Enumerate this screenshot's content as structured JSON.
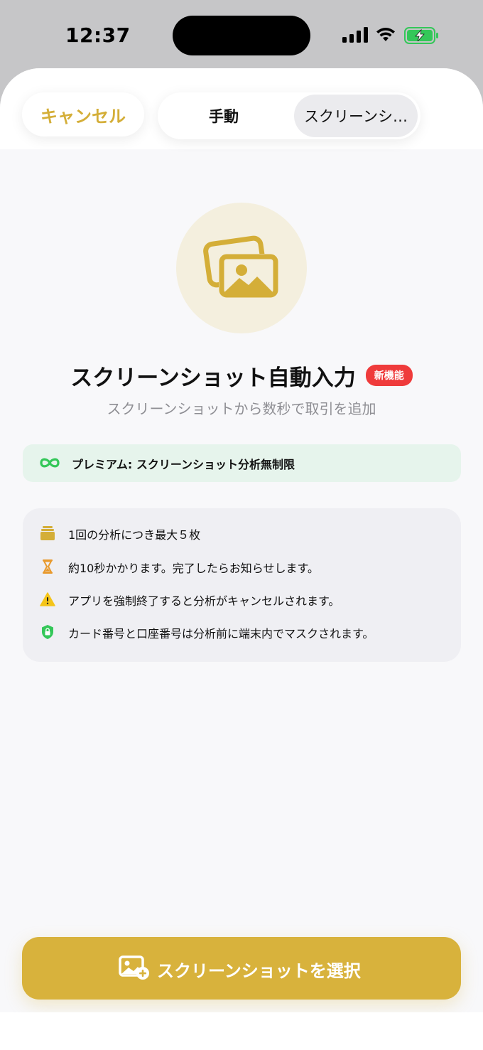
{
  "status_bar": {
    "time": "12:37"
  },
  "header": {
    "cancel_label": "キャンセル",
    "segments": [
      {
        "label": "手動",
        "selected": false
      },
      {
        "label": "スクリーンシ…",
        "selected": true
      }
    ]
  },
  "hero": {
    "icon": "photos-icon",
    "title": "スクリーンショット自動入力",
    "badge": "新機能",
    "subtitle": "スクリーンショットから数秒で取引を追加"
  },
  "premium": {
    "icon": "infinity-icon",
    "text": "プレミアム: スクリーンショット分析無制限"
  },
  "info_items": [
    {
      "icon": "stack-icon",
      "text": "1回の分析につき最大５枚"
    },
    {
      "icon": "hourglass-icon",
      "text": "約10秒かかります。完了したらお知らせします。"
    },
    {
      "icon": "warning-icon",
      "text": "アプリを強制終了すると分析がキャンセルされます。"
    },
    {
      "icon": "lock-shield-icon",
      "text": "カード番号と口座番号は分析前に端末内でマスクされます。"
    }
  ],
  "cta": {
    "icon": "add-photo-icon",
    "label": "スクリーンショットを選択"
  },
  "colors": {
    "accent": "#d4ae38",
    "badge_red": "#ef3b3b",
    "premium_bg": "#e6f4ec",
    "premium_green": "#34c759"
  }
}
